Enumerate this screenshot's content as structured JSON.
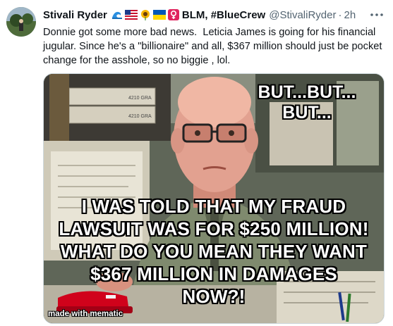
{
  "author": {
    "name": "Stivali Ryder",
    "badges": [
      "wave-emoji",
      "us-flag-emoji",
      "sunflower-emoji",
      "ukraine-flag-emoji",
      "female-sign-emoji"
    ],
    "tagline": "BLM, #BlueCrew",
    "handle": "@StivaliRyder",
    "separator": "·",
    "time": "2h"
  },
  "more_icon": "more-horizontal-icon",
  "tweet_text": "Donnie got some more bad news.  Leticia James is going for his financial\njugular. Since he's a \"billionaire\" and all, $367 million should just be pocket\nchange for the asshole, so no biggie , lol.",
  "meme": {
    "top_caption": [
      "BUT...BUT...",
      "BUT..."
    ],
    "bottom_caption": [
      "I WAS TOLD THAT MY FRAUD",
      "LAWSUIT WAS FOR $250 MILLION!",
      "WHAT DO YOU MEAN THEY WANT",
      "$367 MILLION IN DAMAGES",
      "NOW?!"
    ],
    "box_labels": [
      "4210",
      "GRA",
      "4210",
      "GRA"
    ],
    "watermark": "made with mematic"
  },
  "colors": {
    "text": "#0f1419",
    "secondary": "#536471",
    "border": "#cfd9de",
    "stapler": "#d0021b"
  }
}
